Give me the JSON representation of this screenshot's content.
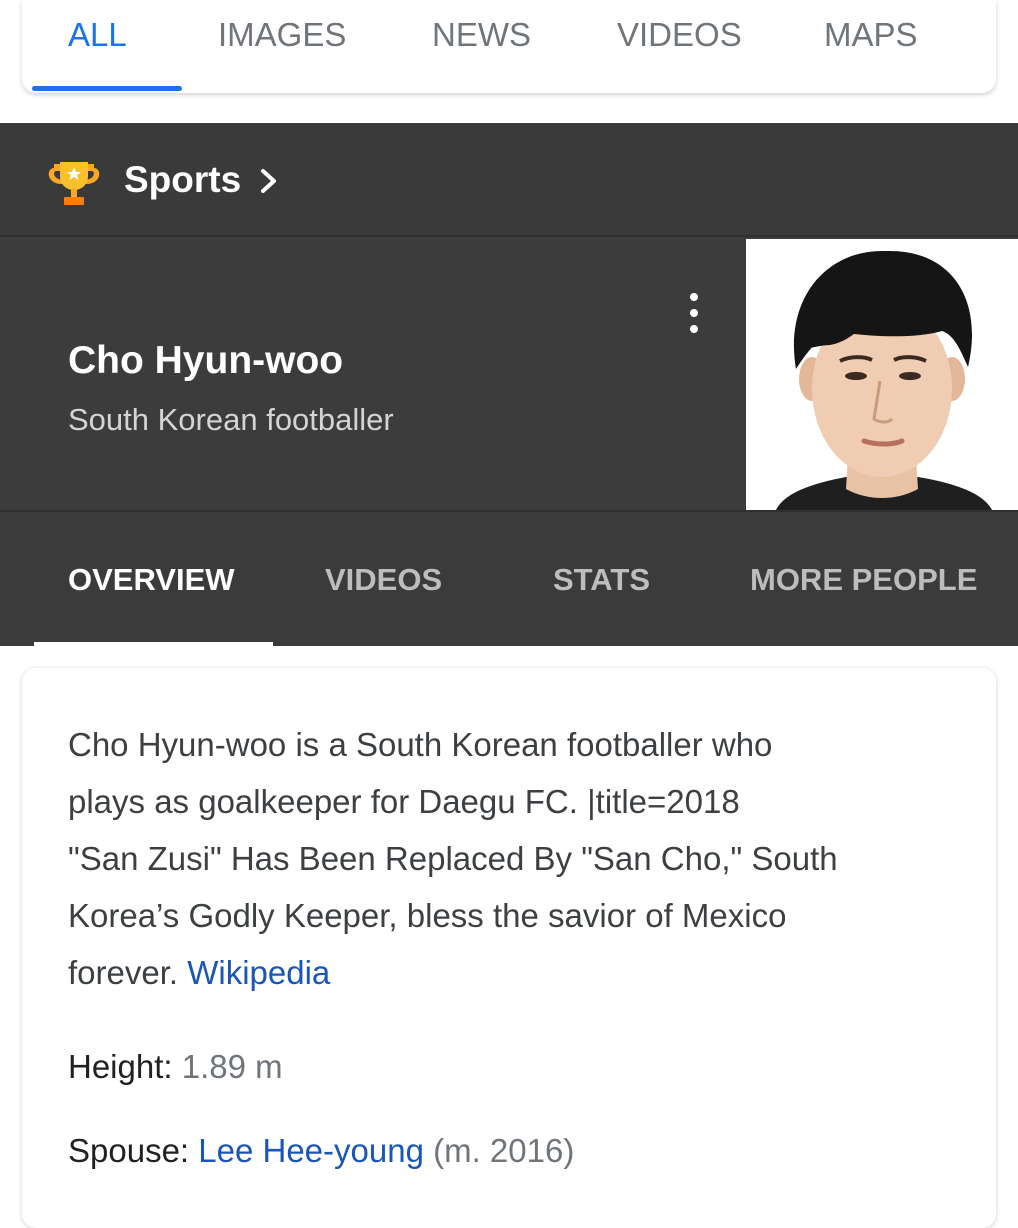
{
  "search_tabs": [
    {
      "label": "ALL",
      "active": true
    },
    {
      "label": "IMAGES",
      "active": false
    },
    {
      "label": "NEWS",
      "active": false
    },
    {
      "label": "VIDEOS",
      "active": false
    },
    {
      "label": "MAPS",
      "active": false
    }
  ],
  "category": {
    "icon": "trophy-icon",
    "label": "Sports"
  },
  "entity": {
    "name": "Cho Hyun-woo",
    "subtitle": "South Korean footballer"
  },
  "entity_tabs": [
    {
      "label": "OVERVIEW",
      "active": true
    },
    {
      "label": "VIDEOS",
      "active": false
    },
    {
      "label": "STATS",
      "active": false
    },
    {
      "label": "MORE PEOPLE",
      "active": false
    }
  ],
  "overview": {
    "description_lines": [
      "Cho Hyun-woo is a South Korean footballer who",
      "plays as goalkeeper for Daegu FC. |title=2018",
      "\"San Zusi\" Has Been Replaced By \"San Cho,\" South",
      "Korea’s Godly Keeper, bless the savior of Mexico",
      "forever. "
    ],
    "source_link": "Wikipedia",
    "facts": {
      "height_label": "Height:",
      "height_value": "1.89 m",
      "spouse_label": "Spouse:",
      "spouse_value": "Lee Hee-young",
      "spouse_extra": "(m. 2016)"
    }
  },
  "colors": {
    "accent_blue": "#1a73e8",
    "link_blue": "#1a55b8",
    "panel_dark": "#3c3c3c",
    "trophy_gold": "#f9a825"
  }
}
